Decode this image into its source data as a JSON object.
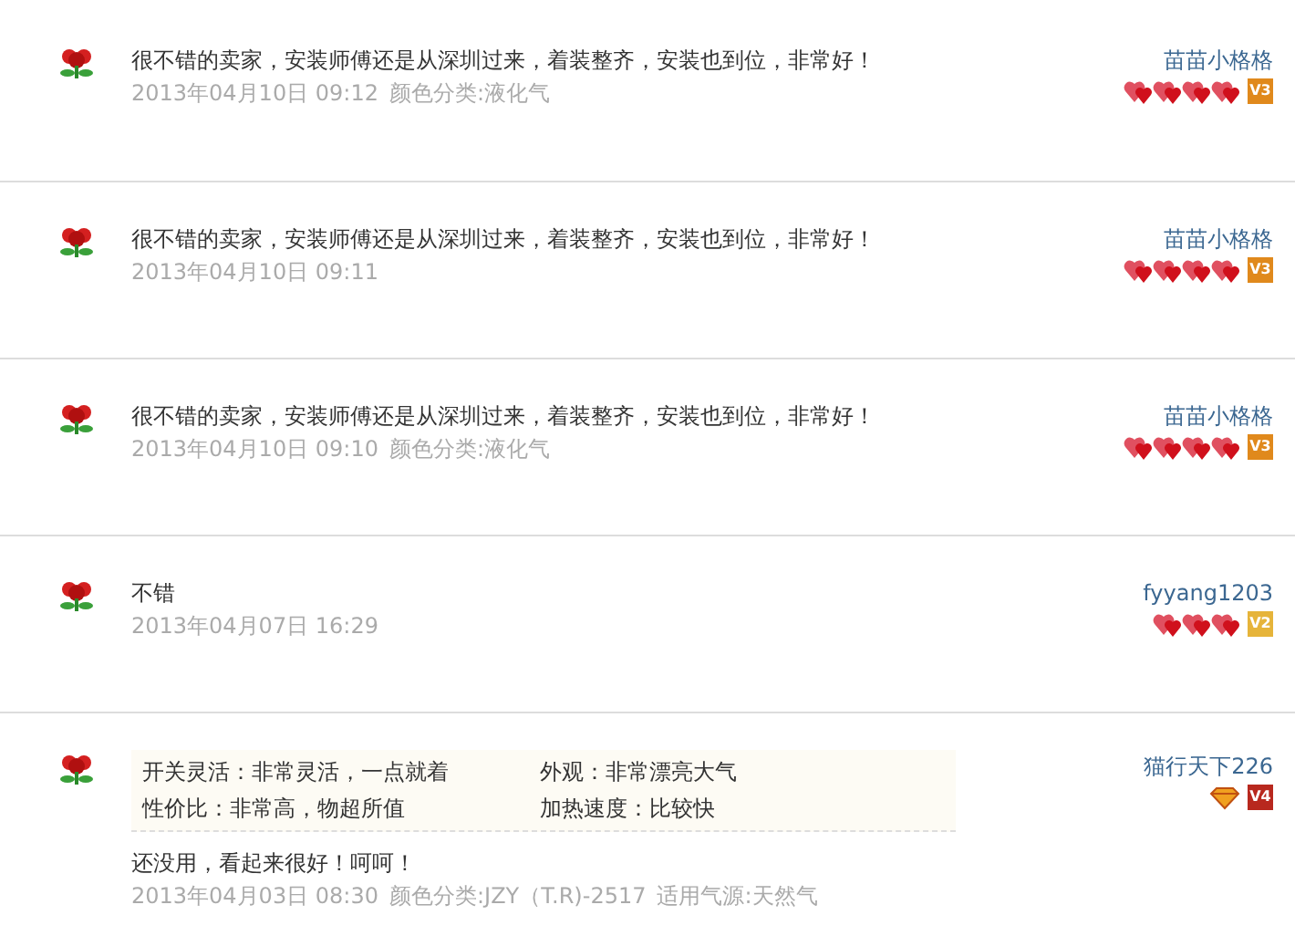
{
  "reviews": [
    {
      "text": "很不错的卖家，安装师傅还是从深圳过来，着装整齐，安装也到位，非常好！",
      "date": "2013年04月10日 09:12",
      "attributes": [
        "颜色分类:液化气"
      ],
      "user": "苗苗小格格",
      "rank_icons": [
        {
          "kind": "heart"
        },
        {
          "kind": "heart"
        },
        {
          "kind": "heart"
        },
        {
          "kind": "heart"
        }
      ],
      "vip_badge": {
        "label": "V3",
        "color": "#e0891c"
      }
    },
    {
      "text": "很不错的卖家，安装师傅还是从深圳过来，着装整齐，安装也到位，非常好！",
      "date": "2013年04月10日 09:11",
      "user": "苗苗小格格",
      "rank_icons": [
        {
          "kind": "heart"
        },
        {
          "kind": "heart"
        },
        {
          "kind": "heart"
        },
        {
          "kind": "heart"
        }
      ],
      "vip_badge": {
        "label": "V3",
        "color": "#e0891c"
      }
    },
    {
      "text": "很不错的卖家，安装师傅还是从深圳过来，着装整齐，安装也到位，非常好！",
      "date": "2013年04月10日 09:10",
      "attributes": [
        "颜色分类:液化气"
      ],
      "user": "苗苗小格格",
      "rank_icons": [
        {
          "kind": "heart"
        },
        {
          "kind": "heart"
        },
        {
          "kind": "heart"
        },
        {
          "kind": "heart"
        }
      ],
      "vip_badge": {
        "label": "V3",
        "color": "#e0891c"
      }
    },
    {
      "text": "不错",
      "date": "2013年04月07日 16:29",
      "user": "fyyang1203",
      "rank_icons": [
        {
          "kind": "heart"
        },
        {
          "kind": "heart"
        },
        {
          "kind": "heart"
        }
      ],
      "vip_badge": {
        "label": "V2",
        "color": "#e6b43a"
      }
    },
    {
      "ratings": [
        {
          "label": "开关灵活：非常灵活，一点就着"
        },
        {
          "label": "外观：非常漂亮大气"
        },
        {
          "label": "性价比：非常高，物超所值"
        },
        {
          "label": "加热速度：比较快"
        }
      ],
      "text": "还没用，看起来很好！呵呵！",
      "date": "2013年04月03日 08:30",
      "attributes": [
        "颜色分类:JZY（T.R)-2517",
        "适用气源:天然气"
      ],
      "user": "猫行天下226",
      "rank_icons": [
        {
          "kind": "diamond"
        }
      ],
      "vip_badge": {
        "label": "V4",
        "color": "#b8281e"
      }
    }
  ]
}
